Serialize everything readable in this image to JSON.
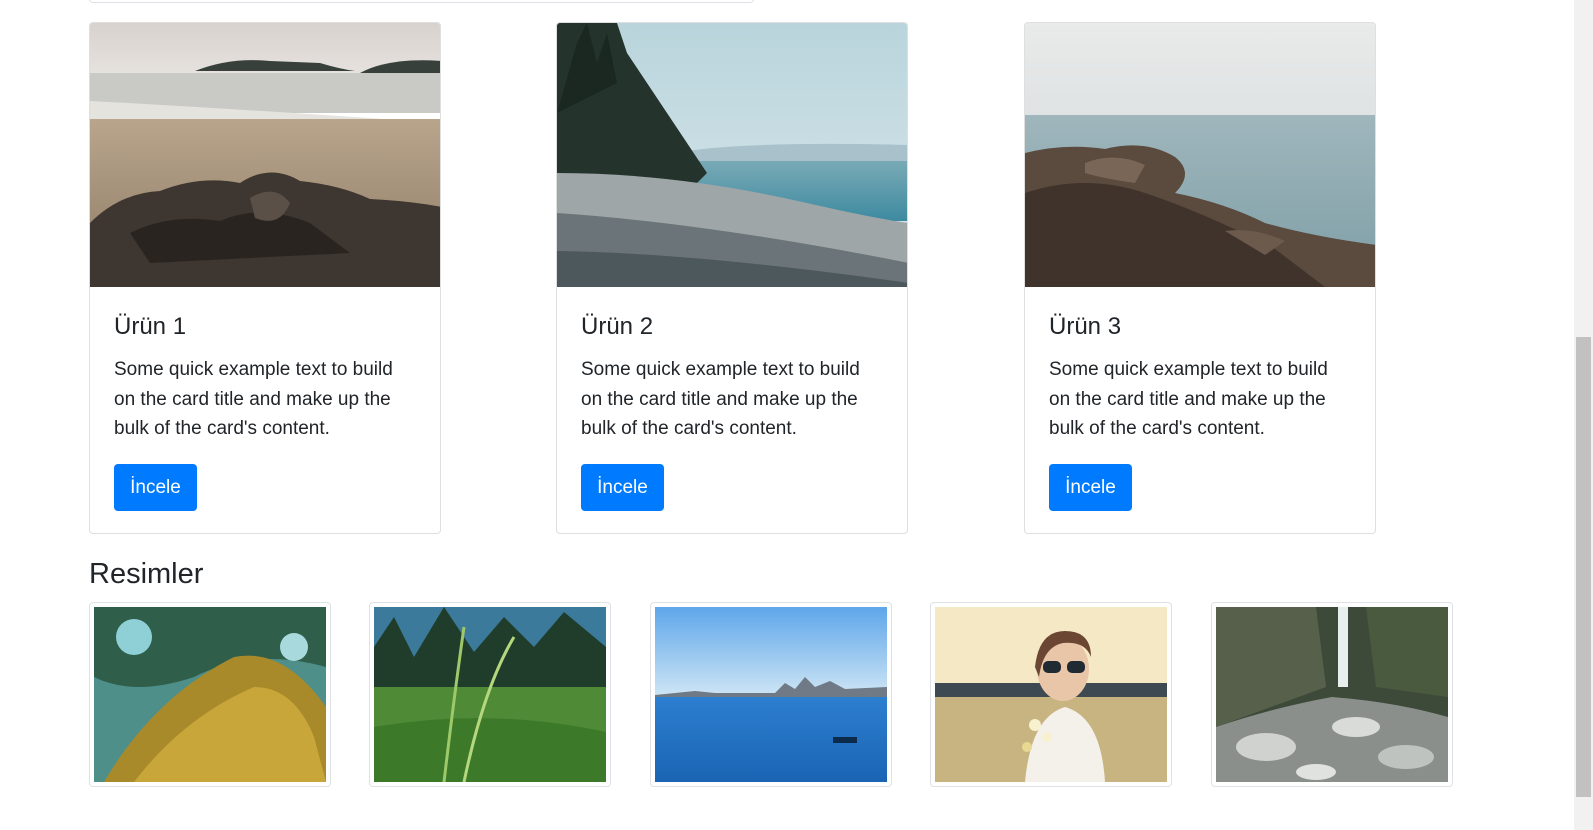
{
  "products": [
    {
      "title": "Ürün 1",
      "text": "Some quick example text to build on the card title and make up the bulk of the card's content.",
      "button": "İncele",
      "image": "rocky-beach-islands"
    },
    {
      "title": "Ürün 2",
      "text": "Some quick example text to build on the card title and make up the bulk of the card's content.",
      "button": "İncele",
      "image": "pebble-shore-forest"
    },
    {
      "title": "Ürün 3",
      "text": "Some quick example text to build on the card title and make up the bulk of the card's content.",
      "button": "İncele",
      "image": "rocky-coast-sea"
    }
  ],
  "gallery": {
    "title": "Resimler",
    "images": [
      "mossy-tree-trunk",
      "tall-grass-field",
      "bay-city-skyline",
      "woman-sunglasses-flowers",
      "waterfall-rocks"
    ]
  },
  "colors": {
    "accent": "#007bff",
    "border": "#dee2e6",
    "text": "#212529"
  }
}
